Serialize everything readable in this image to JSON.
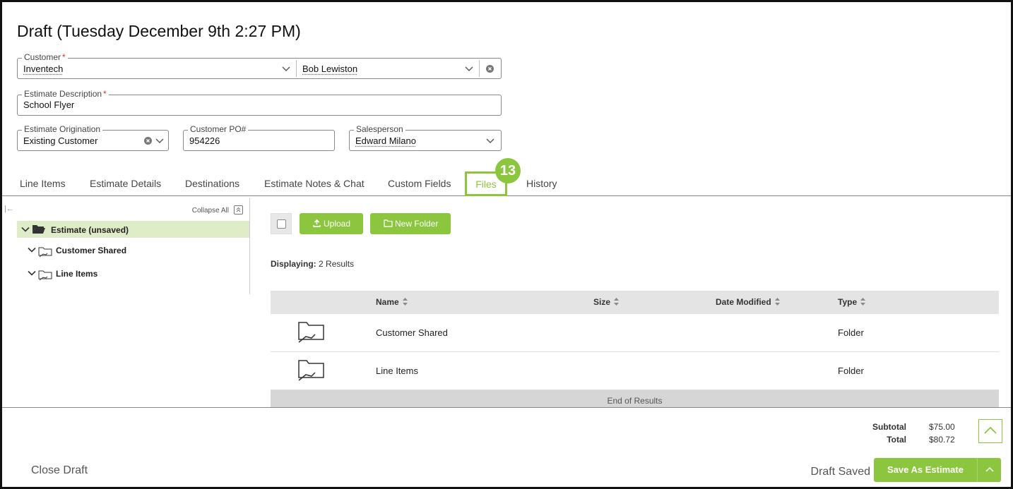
{
  "title": "Draft (Tuesday December 9th 2:27 PM)",
  "form": {
    "customer": {
      "label": "Customer",
      "required": "*",
      "value": "Inventech",
      "contact": "Bob Lewiston"
    },
    "description": {
      "label": "Estimate Description",
      "required": "*",
      "value": "School Flyer"
    },
    "origination": {
      "label": "Estimate Origination",
      "value": "Existing Customer"
    },
    "po": {
      "label": "Customer PO#",
      "value": "954226"
    },
    "salesperson": {
      "label": "Salesperson",
      "value": "Edward Milano"
    }
  },
  "tabs": [
    "Line Items",
    "Estimate Details",
    "Destinations",
    "Estimate Notes & Chat",
    "Custom Fields",
    "Files",
    "History"
  ],
  "active_tab": "Files",
  "step_badge": "13",
  "tree": {
    "collapse_all": "Collapse All",
    "back": "|←",
    "root": "Estimate (unsaved)",
    "children": [
      "Customer Shared",
      "Line Items"
    ]
  },
  "toolbar": {
    "upload": "Upload",
    "new_folder": "New Folder"
  },
  "displaying": {
    "label": "Displaying:",
    "value": "2 Results"
  },
  "table": {
    "columns": [
      "Name",
      "Size",
      "Date Modified",
      "Type"
    ],
    "rows": [
      {
        "icon": "shared-folder-icon",
        "name": "Customer Shared",
        "size": "",
        "date": "",
        "type": "Folder"
      },
      {
        "icon": "shared-folder-icon",
        "name": "Line Items",
        "size": "",
        "date": "",
        "type": "Folder"
      }
    ],
    "end": "End of Results"
  },
  "totals": {
    "subtotal_label": "Subtotal",
    "subtotal": "$75.00",
    "total_label": "Total",
    "total": "$80.72"
  },
  "footer": {
    "close": "Close Draft",
    "status": "Draft Saved",
    "save": "Save As Estimate"
  },
  "colors": {
    "accent": "#8cc63f",
    "tree_highlight": "#dfecc8"
  }
}
